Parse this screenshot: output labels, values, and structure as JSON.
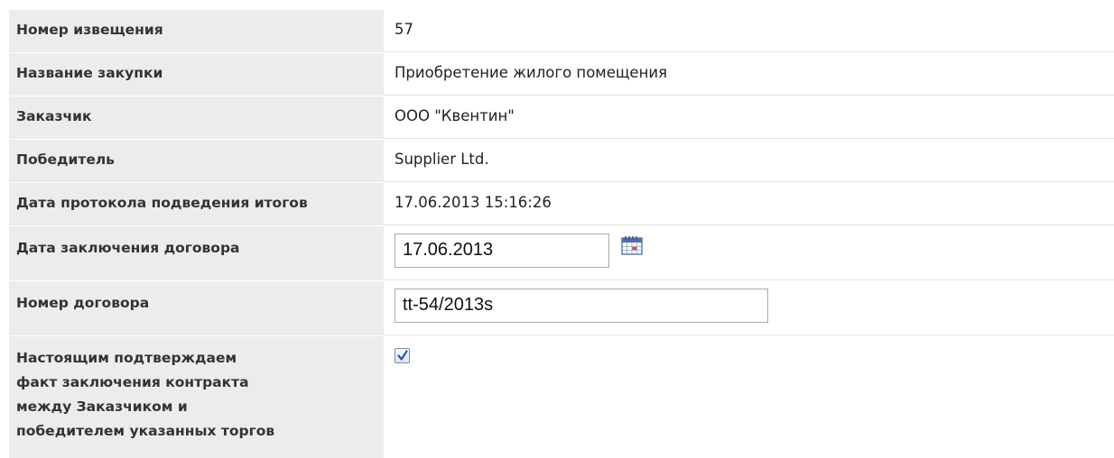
{
  "form": {
    "rows": [
      {
        "label": "Номер извещения",
        "value": "57"
      },
      {
        "label": "Название закупки",
        "value": "Приобретение жилого помещения"
      },
      {
        "label": "Заказчик",
        "value": "ООО \"Квентин\""
      },
      {
        "label": "Победитель",
        "value": "Supplier Ltd."
      },
      {
        "label": "Дата протокола подведения итогов",
        "value": "17.06.2013 15:16:26"
      },
      {
        "label": "Дата заключения договора",
        "value": "17.06.2013"
      },
      {
        "label": "Номер договора",
        "value": "tt-54/2013s"
      },
      {
        "label": "Настоящим подтверждаем факт заключения контракта между Заказчиком и победителем указанных торгов",
        "checked": true
      }
    ]
  },
  "icons": {
    "calendar": "calendar-icon",
    "checkbox": "checkmark-icon"
  },
  "colors": {
    "label_bg": "#ececec",
    "row_divider": "#e4e4e4",
    "checkbox_check": "#2a57a8"
  }
}
